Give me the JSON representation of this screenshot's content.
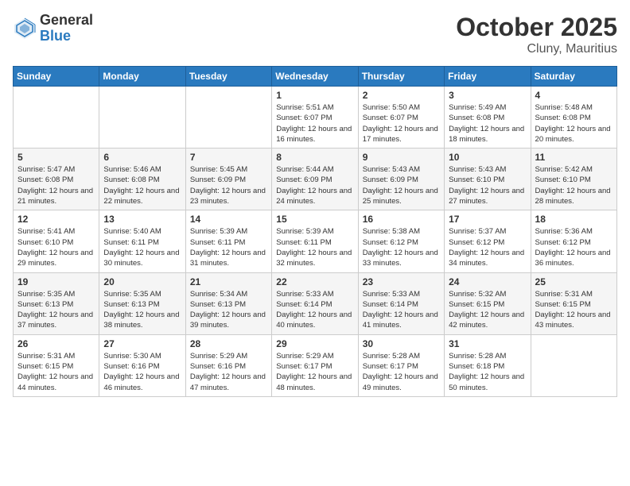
{
  "header": {
    "logo_general": "General",
    "logo_blue": "Blue",
    "month_title": "October 2025",
    "location": "Cluny, Mauritius"
  },
  "days_of_week": [
    "Sunday",
    "Monday",
    "Tuesday",
    "Wednesday",
    "Thursday",
    "Friday",
    "Saturday"
  ],
  "weeks": [
    [
      {
        "day": "",
        "info": ""
      },
      {
        "day": "",
        "info": ""
      },
      {
        "day": "",
        "info": ""
      },
      {
        "day": "1",
        "info": "Sunrise: 5:51 AM\nSunset: 6:07 PM\nDaylight: 12 hours and 16 minutes."
      },
      {
        "day": "2",
        "info": "Sunrise: 5:50 AM\nSunset: 6:07 PM\nDaylight: 12 hours and 17 minutes."
      },
      {
        "day": "3",
        "info": "Sunrise: 5:49 AM\nSunset: 6:08 PM\nDaylight: 12 hours and 18 minutes."
      },
      {
        "day": "4",
        "info": "Sunrise: 5:48 AM\nSunset: 6:08 PM\nDaylight: 12 hours and 20 minutes."
      }
    ],
    [
      {
        "day": "5",
        "info": "Sunrise: 5:47 AM\nSunset: 6:08 PM\nDaylight: 12 hours and 21 minutes."
      },
      {
        "day": "6",
        "info": "Sunrise: 5:46 AM\nSunset: 6:08 PM\nDaylight: 12 hours and 22 minutes."
      },
      {
        "day": "7",
        "info": "Sunrise: 5:45 AM\nSunset: 6:09 PM\nDaylight: 12 hours and 23 minutes."
      },
      {
        "day": "8",
        "info": "Sunrise: 5:44 AM\nSunset: 6:09 PM\nDaylight: 12 hours and 24 minutes."
      },
      {
        "day": "9",
        "info": "Sunrise: 5:43 AM\nSunset: 6:09 PM\nDaylight: 12 hours and 25 minutes."
      },
      {
        "day": "10",
        "info": "Sunrise: 5:43 AM\nSunset: 6:10 PM\nDaylight: 12 hours and 27 minutes."
      },
      {
        "day": "11",
        "info": "Sunrise: 5:42 AM\nSunset: 6:10 PM\nDaylight: 12 hours and 28 minutes."
      }
    ],
    [
      {
        "day": "12",
        "info": "Sunrise: 5:41 AM\nSunset: 6:10 PM\nDaylight: 12 hours and 29 minutes."
      },
      {
        "day": "13",
        "info": "Sunrise: 5:40 AM\nSunset: 6:11 PM\nDaylight: 12 hours and 30 minutes."
      },
      {
        "day": "14",
        "info": "Sunrise: 5:39 AM\nSunset: 6:11 PM\nDaylight: 12 hours and 31 minutes."
      },
      {
        "day": "15",
        "info": "Sunrise: 5:39 AM\nSunset: 6:11 PM\nDaylight: 12 hours and 32 minutes."
      },
      {
        "day": "16",
        "info": "Sunrise: 5:38 AM\nSunset: 6:12 PM\nDaylight: 12 hours and 33 minutes."
      },
      {
        "day": "17",
        "info": "Sunrise: 5:37 AM\nSunset: 6:12 PM\nDaylight: 12 hours and 34 minutes."
      },
      {
        "day": "18",
        "info": "Sunrise: 5:36 AM\nSunset: 6:12 PM\nDaylight: 12 hours and 36 minutes."
      }
    ],
    [
      {
        "day": "19",
        "info": "Sunrise: 5:35 AM\nSunset: 6:13 PM\nDaylight: 12 hours and 37 minutes."
      },
      {
        "day": "20",
        "info": "Sunrise: 5:35 AM\nSunset: 6:13 PM\nDaylight: 12 hours and 38 minutes."
      },
      {
        "day": "21",
        "info": "Sunrise: 5:34 AM\nSunset: 6:13 PM\nDaylight: 12 hours and 39 minutes."
      },
      {
        "day": "22",
        "info": "Sunrise: 5:33 AM\nSunset: 6:14 PM\nDaylight: 12 hours and 40 minutes."
      },
      {
        "day": "23",
        "info": "Sunrise: 5:33 AM\nSunset: 6:14 PM\nDaylight: 12 hours and 41 minutes."
      },
      {
        "day": "24",
        "info": "Sunrise: 5:32 AM\nSunset: 6:15 PM\nDaylight: 12 hours and 42 minutes."
      },
      {
        "day": "25",
        "info": "Sunrise: 5:31 AM\nSunset: 6:15 PM\nDaylight: 12 hours and 43 minutes."
      }
    ],
    [
      {
        "day": "26",
        "info": "Sunrise: 5:31 AM\nSunset: 6:15 PM\nDaylight: 12 hours and 44 minutes."
      },
      {
        "day": "27",
        "info": "Sunrise: 5:30 AM\nSunset: 6:16 PM\nDaylight: 12 hours and 46 minutes."
      },
      {
        "day": "28",
        "info": "Sunrise: 5:29 AM\nSunset: 6:16 PM\nDaylight: 12 hours and 47 minutes."
      },
      {
        "day": "29",
        "info": "Sunrise: 5:29 AM\nSunset: 6:17 PM\nDaylight: 12 hours and 48 minutes."
      },
      {
        "day": "30",
        "info": "Sunrise: 5:28 AM\nSunset: 6:17 PM\nDaylight: 12 hours and 49 minutes."
      },
      {
        "day": "31",
        "info": "Sunrise: 5:28 AM\nSunset: 6:18 PM\nDaylight: 12 hours and 50 minutes."
      },
      {
        "day": "",
        "info": ""
      }
    ]
  ]
}
